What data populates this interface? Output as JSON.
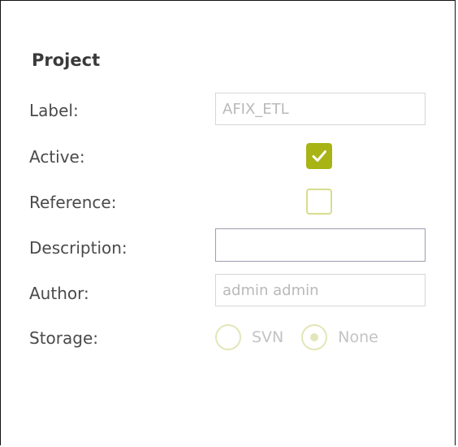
{
  "section": {
    "title": "Project"
  },
  "form": {
    "label": {
      "caption": "Label:",
      "value": "AFIX_ETL"
    },
    "active": {
      "caption": "Active:",
      "checked": true
    },
    "reference": {
      "caption": "Reference:",
      "checked": false
    },
    "description": {
      "caption": "Description:",
      "value": ""
    },
    "author": {
      "caption": "Author:",
      "value": "admin admin"
    },
    "storage": {
      "caption": "Storage:",
      "options": [
        {
          "label": "SVN",
          "selected": false
        },
        {
          "label": "None",
          "selected": true
        }
      ]
    }
  },
  "colors": {
    "accent": "#a7b414",
    "accent_light": "#d8dc8f",
    "disabled_text": "#b9b9b9"
  }
}
